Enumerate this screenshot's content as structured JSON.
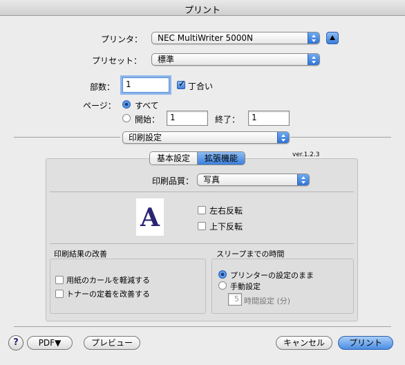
{
  "window": {
    "title": "プリント"
  },
  "printer": {
    "label": "プリンタ：",
    "value": "NEC MultiWriter 5000N"
  },
  "preset": {
    "label": "プリセット：",
    "value": "標準"
  },
  "copies": {
    "label": "部数：",
    "value": "1",
    "collate_label": "丁合い",
    "collate_checked": true
  },
  "pages": {
    "label": "ページ：",
    "all_label": "すべて",
    "from_label": "開始：",
    "from_value": "1",
    "to_label": "終了：",
    "to_value": "1",
    "selected": "all"
  },
  "section_popup": {
    "value": "印刷設定"
  },
  "tabs": {
    "items": [
      "基本設定",
      "拡張機能"
    ],
    "selected": 1
  },
  "version": "ver.1.2.3",
  "quality": {
    "label": "印刷品質：",
    "value": "写真"
  },
  "preview_letter": "A",
  "flip": {
    "horizontal_label": "左右反転",
    "vertical_label": "上下反転",
    "horizontal_checked": false,
    "vertical_checked": false
  },
  "improve": {
    "title": "印刷結果の改善",
    "curl_label": "用紙のカールを軽減する",
    "toner_label": "トナーの定着を改善する",
    "curl_checked": false,
    "toner_checked": false
  },
  "sleep": {
    "title": "スリープまでの時間",
    "printer_setting_label": "プリンターの設定のまま",
    "manual_label": "手動設定",
    "hours_value": "5",
    "hours_label": "時間設定 (分)",
    "selected": "printer"
  },
  "buttons": {
    "help": "?",
    "pdf": "PDF▼",
    "preview": "プレビュー",
    "cancel": "キャンセル",
    "print": "プリント"
  },
  "colors": {
    "accent": "#3a7fdb",
    "preview_letter": "#2b2475"
  }
}
